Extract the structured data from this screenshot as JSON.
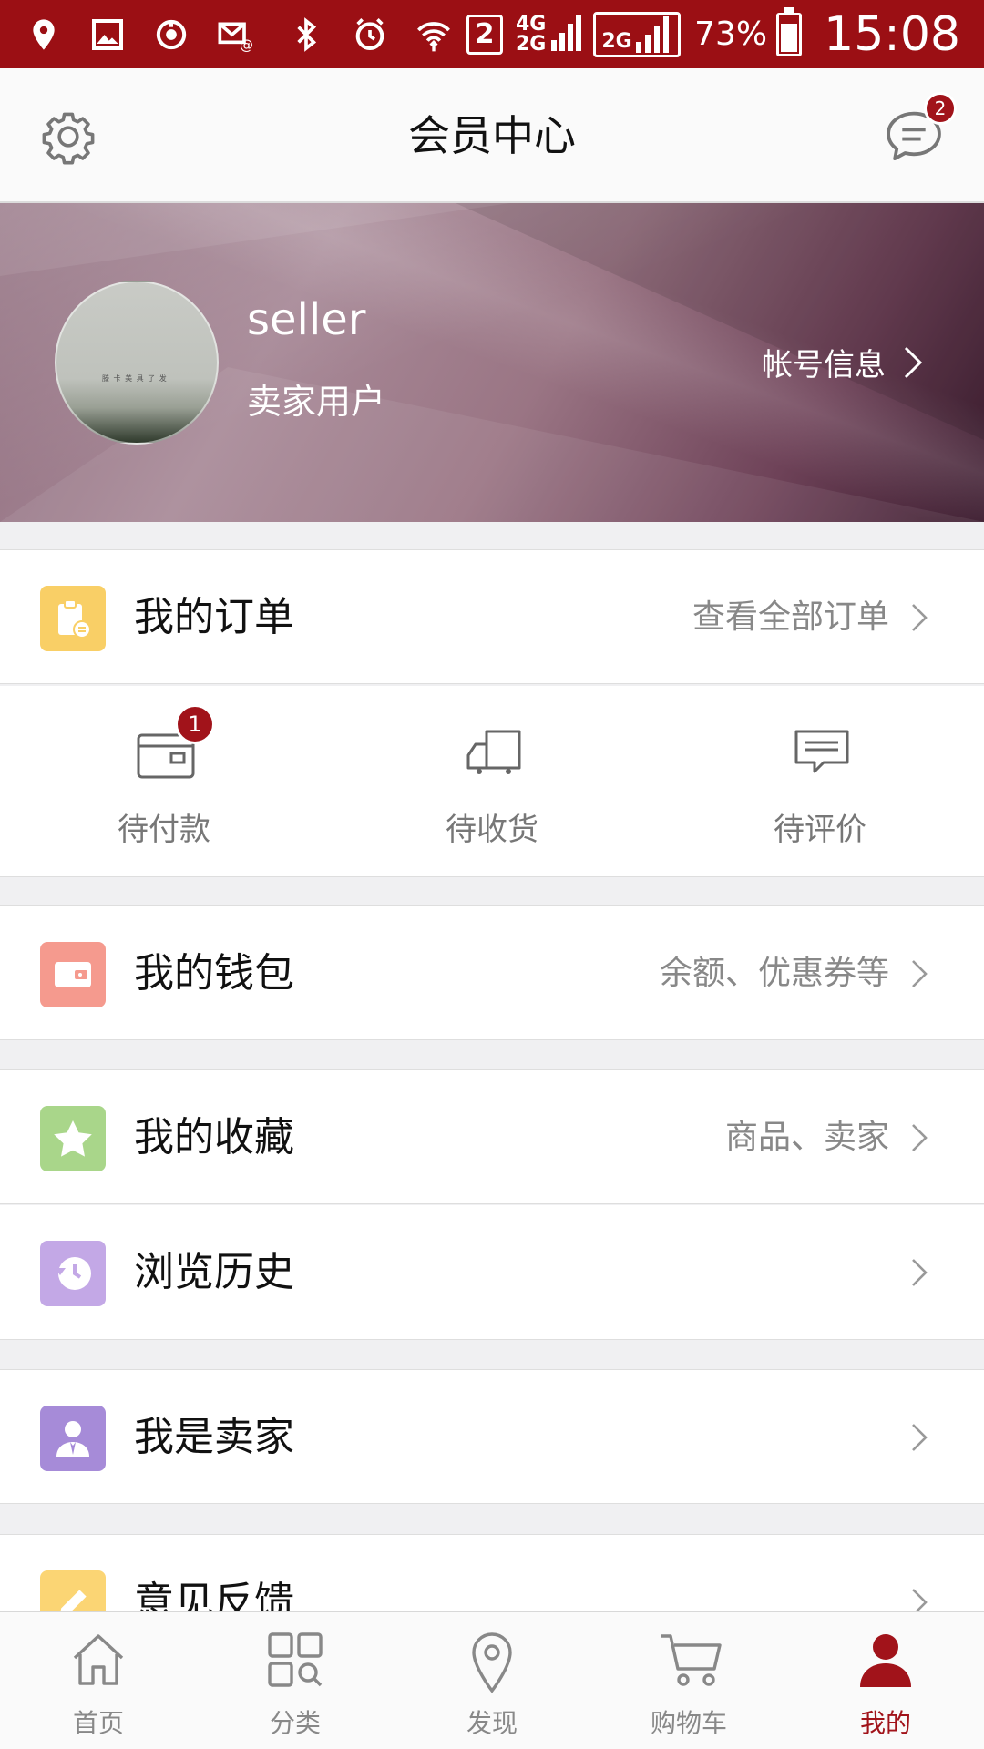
{
  "status_bar": {
    "network_4g": "4G",
    "network_2g": "2G",
    "sim_slot": "2",
    "network_2g_box": "2G",
    "battery_percent": "73%",
    "battery_level": 0.73,
    "time": "15:08"
  },
  "header": {
    "title": "会员中心",
    "settings_icon": "gear-icon",
    "message_icon": "chat-bubble-icon",
    "message_badge": "2"
  },
  "profile": {
    "username": "seller",
    "user_type": "卖家用户",
    "account_info_label": "帐号信息",
    "avatar_caption": "滕 卡 美 具 了 发"
  },
  "orders": {
    "label": "我的订单",
    "hint": "查看全部订单",
    "icon": "clipboard-icon",
    "icon_color": "#f9cf66",
    "sub_items": [
      {
        "label": "待付款",
        "icon": "wallet-card-icon",
        "badge": "1"
      },
      {
        "label": "待收货",
        "icon": "truck-icon",
        "badge": ""
      },
      {
        "label": "待评价",
        "icon": "comment-icon",
        "badge": ""
      }
    ]
  },
  "wallet": {
    "label": "我的钱包",
    "hint": "余额、优惠券等",
    "icon": "wallet-icon",
    "icon_color": "#f59a8e"
  },
  "favorites": {
    "label": "我的收藏",
    "hint": "商品、卖家",
    "icon": "star-icon",
    "icon_color": "#a9d68a"
  },
  "history": {
    "label": "浏览历史",
    "hint": "",
    "icon": "clock-icon",
    "icon_color": "#c3a8e6"
  },
  "seller": {
    "label": "我是卖家",
    "hint": "",
    "icon": "seller-person-icon",
    "icon_color": "#a68bd8"
  },
  "feedback": {
    "label": "意见反馈",
    "icon": "pencil-icon",
    "icon_color": "#fbd574"
  },
  "bottom_nav": [
    {
      "label": "首页",
      "icon": "home-icon",
      "active": false
    },
    {
      "label": "分类",
      "icon": "category-icon",
      "active": false
    },
    {
      "label": "发现",
      "icon": "location-pin-icon",
      "active": false
    },
    {
      "label": "购物车",
      "icon": "cart-icon",
      "active": false
    },
    {
      "label": "我的",
      "icon": "user-icon",
      "active": true
    }
  ],
  "colors": {
    "brand": "#9b0f14",
    "badge": "#a1131a",
    "active_nav": "#a1131a"
  }
}
